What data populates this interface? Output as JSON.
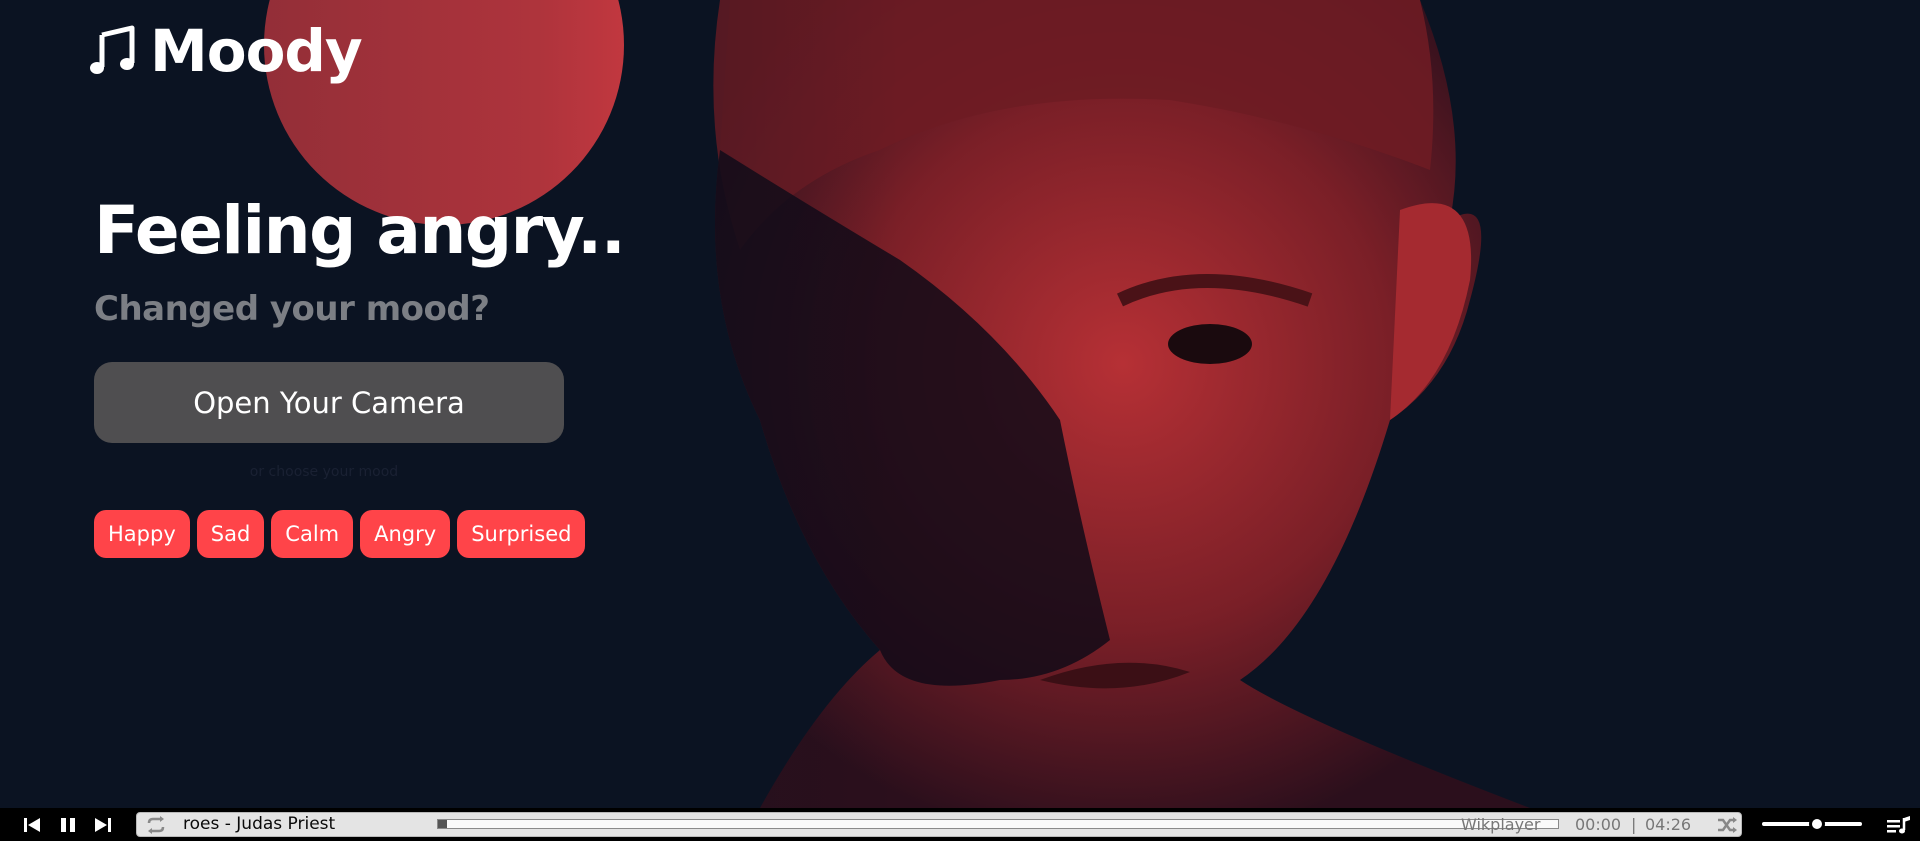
{
  "app": {
    "logo_text": "Moody",
    "logo_icon": "music-note-icon"
  },
  "hero": {
    "headline": "Feeling angry..",
    "subline": "Changed your mood?",
    "camera_button": "Open Your Camera",
    "alt_text": "or choose your mood",
    "moods": [
      "Happy",
      "Sad",
      "Calm",
      "Angry",
      "Surprised"
    ],
    "accent_color": "#ff4449",
    "background_color": "#0b1322"
  },
  "player": {
    "controls": [
      "skip-back-icon",
      "pause-icon",
      "skip-forward-icon"
    ],
    "track_title": "roes - Judas Priest",
    "player_name": "Wikplayer",
    "time_current": "00:00",
    "time_separator": "|",
    "time_total": "04:26",
    "progress": 0.005,
    "volume": 0.55
  }
}
